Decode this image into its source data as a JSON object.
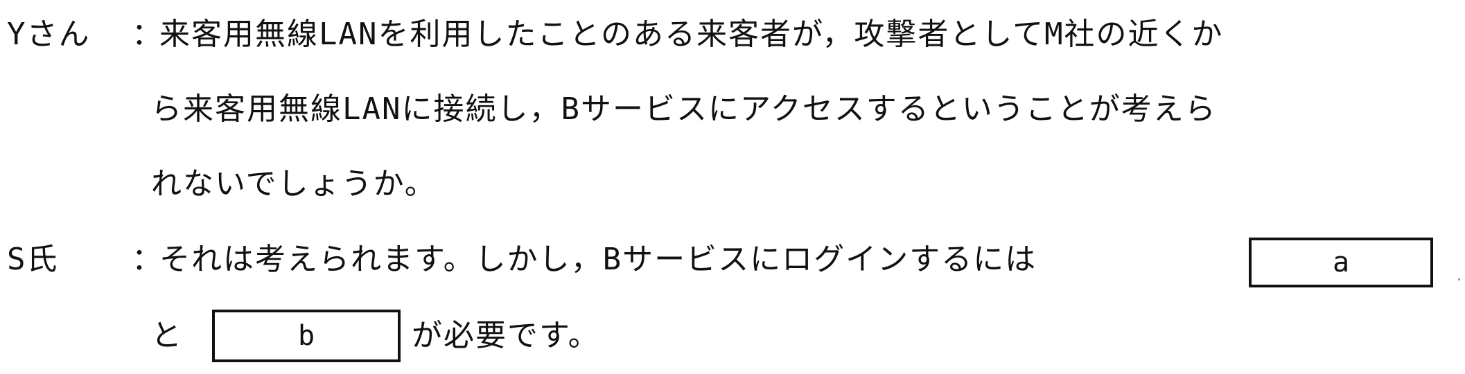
{
  "dialogue": [
    {
      "speaker": "Yさん",
      "colon": "：",
      "lines": [
        "来客用無線LANを利用したことのある来客者が，攻撃者としてM社の近くか",
        "ら来客用無線LANに接続し，Bサービスにアクセスするということが考えら",
        "れないでしょうか。"
      ]
    },
    {
      "speaker": "S氏",
      "colon": "：",
      "lines": [
        "それは考えられます。しかし，Bサービスにログインするには",
        "と",
        "が必要です。"
      ],
      "blanks": [
        "a",
        "b"
      ]
    }
  ]
}
